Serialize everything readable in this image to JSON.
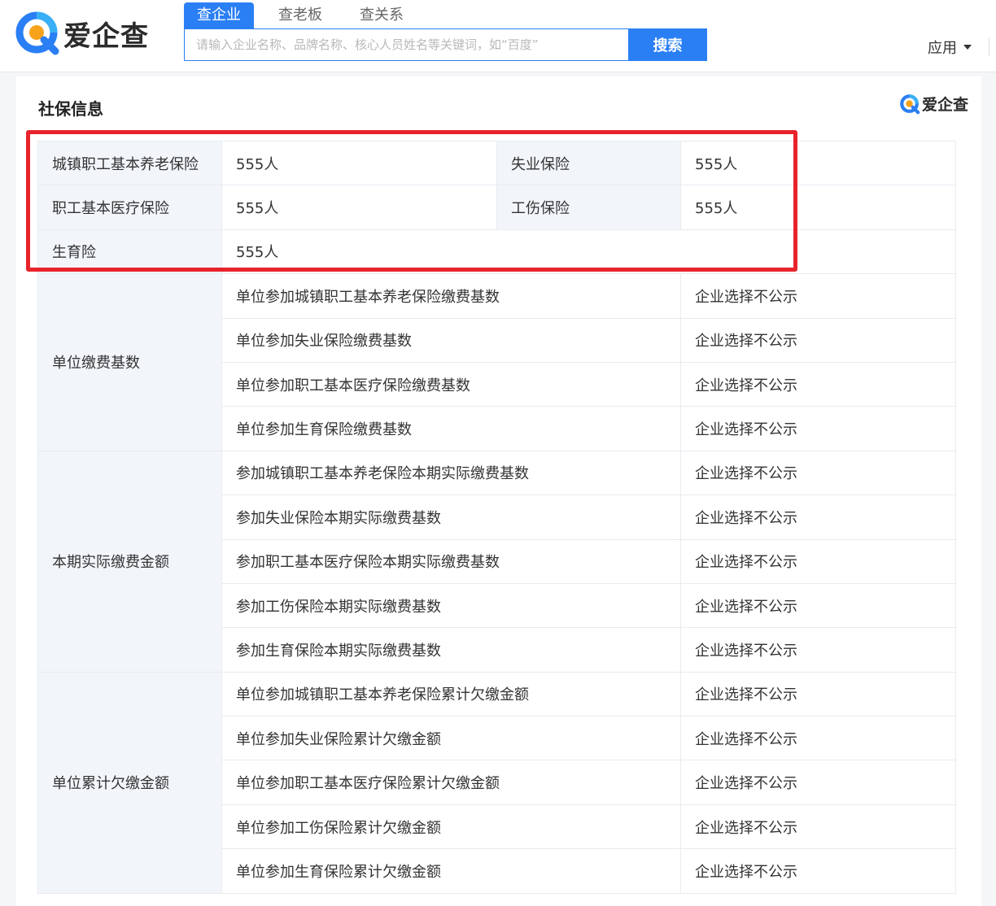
{
  "brand": {
    "logo_text": "爱企查"
  },
  "search": {
    "tabs": [
      "查企业",
      "查老板",
      "查关系"
    ],
    "placeholder": "请输入企业名称、品牌名称、核心人员姓名等关键词，如“百度”",
    "button": "搜索"
  },
  "nav": {
    "apps": "应用"
  },
  "section": {
    "title": "社保信息",
    "brand": "爱企查"
  },
  "summary": {
    "r1": {
      "l1": "城镇职工基本养老保险",
      "v1": "555人",
      "l2": "失业保险",
      "v2": "555人"
    },
    "r2": {
      "l1": "职工基本医疗保险",
      "v1": "555人",
      "l2": "工伤保险",
      "v2": "555人"
    },
    "r3": {
      "l1": "生育险",
      "v1": "555人"
    }
  },
  "groups": {
    "g1": {
      "label": "单位缴费基数",
      "rows": [
        {
          "item": "单位参加城镇职工基本养老保险缴费基数",
          "value": "企业选择不公示"
        },
        {
          "item": "单位参加失业保险缴费基数",
          "value": "企业选择不公示"
        },
        {
          "item": "单位参加职工基本医疗保险缴费基数",
          "value": "企业选择不公示"
        },
        {
          "item": "单位参加生育保险缴费基数",
          "value": "企业选择不公示"
        }
      ]
    },
    "g2": {
      "label": "本期实际缴费金额",
      "rows": [
        {
          "item": "参加城镇职工基本养老保险本期实际缴费基数",
          "value": "企业选择不公示"
        },
        {
          "item": "参加失业保险本期实际缴费基数",
          "value": "企业选择不公示"
        },
        {
          "item": "参加职工基本医疗保险本期实际缴费基数",
          "value": "企业选择不公示"
        },
        {
          "item": "参加工伤保险本期实际缴费基数",
          "value": "企业选择不公示"
        },
        {
          "item": "参加生育保险本期实际缴费基数",
          "value": "企业选择不公示"
        }
      ]
    },
    "g3": {
      "label": "单位累计欠缴金额",
      "rows": [
        {
          "item": "单位参加城镇职工基本养老保险累计欠缴金额",
          "value": "企业选择不公示"
        },
        {
          "item": "单位参加失业保险累计欠缴金额",
          "value": "企业选择不公示"
        },
        {
          "item": "单位参加职工基本医疗保险累计欠缴金额",
          "value": "企业选择不公示"
        },
        {
          "item": "单位参加工伤保险累计欠缴金额",
          "value": "企业选择不公示"
        },
        {
          "item": "单位参加生育保险累计欠缴金额",
          "value": "企业选择不公示"
        }
      ]
    }
  },
  "colors": {
    "accent": "#2b7ff4",
    "label_bg": "#f2f6fb",
    "highlight": "#e8232b"
  }
}
